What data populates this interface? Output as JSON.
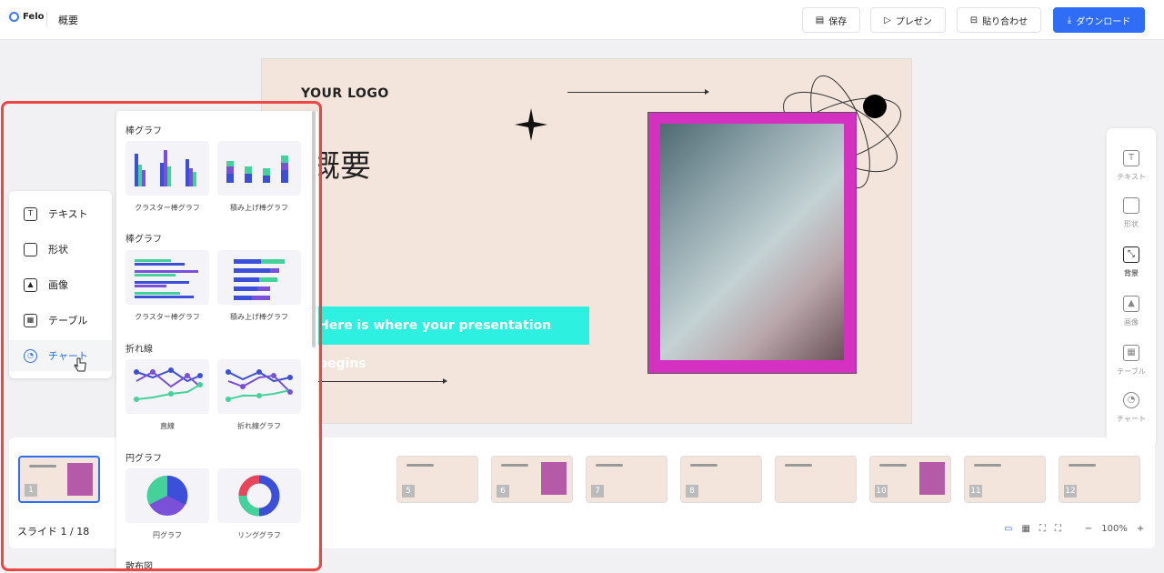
{
  "topbar": {
    "app_name": "Felo",
    "doc_title": "概要",
    "save": "保存",
    "present": "プレゼン",
    "paste": "貼り合わせ",
    "download": "ダウンロード"
  },
  "slide": {
    "logo": "YOUR LOGO",
    "heading": "概要",
    "subtitle": "Here is where your presentation begins"
  },
  "right_panel": {
    "items": [
      "テキスト",
      "形状",
      "背景",
      "画像",
      "テーブル",
      "チャート"
    ],
    "active": "背景"
  },
  "insert_menu": {
    "items": [
      "テキスト",
      "形状",
      "画像",
      "テーブル",
      "チャート"
    ],
    "active": "チャート"
  },
  "chart_panel": {
    "sections": [
      {
        "title": "棒グラフ",
        "items": [
          "クラスター棒グラフ",
          "積み上げ棒グラフ"
        ]
      },
      {
        "title": "棒グラフ",
        "items": [
          "クラスター棒グラフ",
          "積み上げ棒グラフ"
        ]
      },
      {
        "title": "折れ線",
        "items": [
          "直線",
          "折れ線グラフ"
        ]
      },
      {
        "title": "円グラフ",
        "items": [
          "円グラフ",
          "リンググラフ"
        ]
      },
      {
        "title": "散布図",
        "items": []
      }
    ]
  },
  "filmstrip": {
    "count_label": "スライド",
    "current": "1 / 18",
    "numbers": [
      "1",
      "5",
      "6",
      "7",
      "8",
      "10",
      "11",
      "12"
    ],
    "zoom": "100%"
  },
  "colors": {
    "accent": "#2f6df6",
    "highlight": "#ee4444",
    "chart_blue": "#3b4fd8",
    "chart_purple": "#7b50d8",
    "chart_green": "#45d19a"
  }
}
